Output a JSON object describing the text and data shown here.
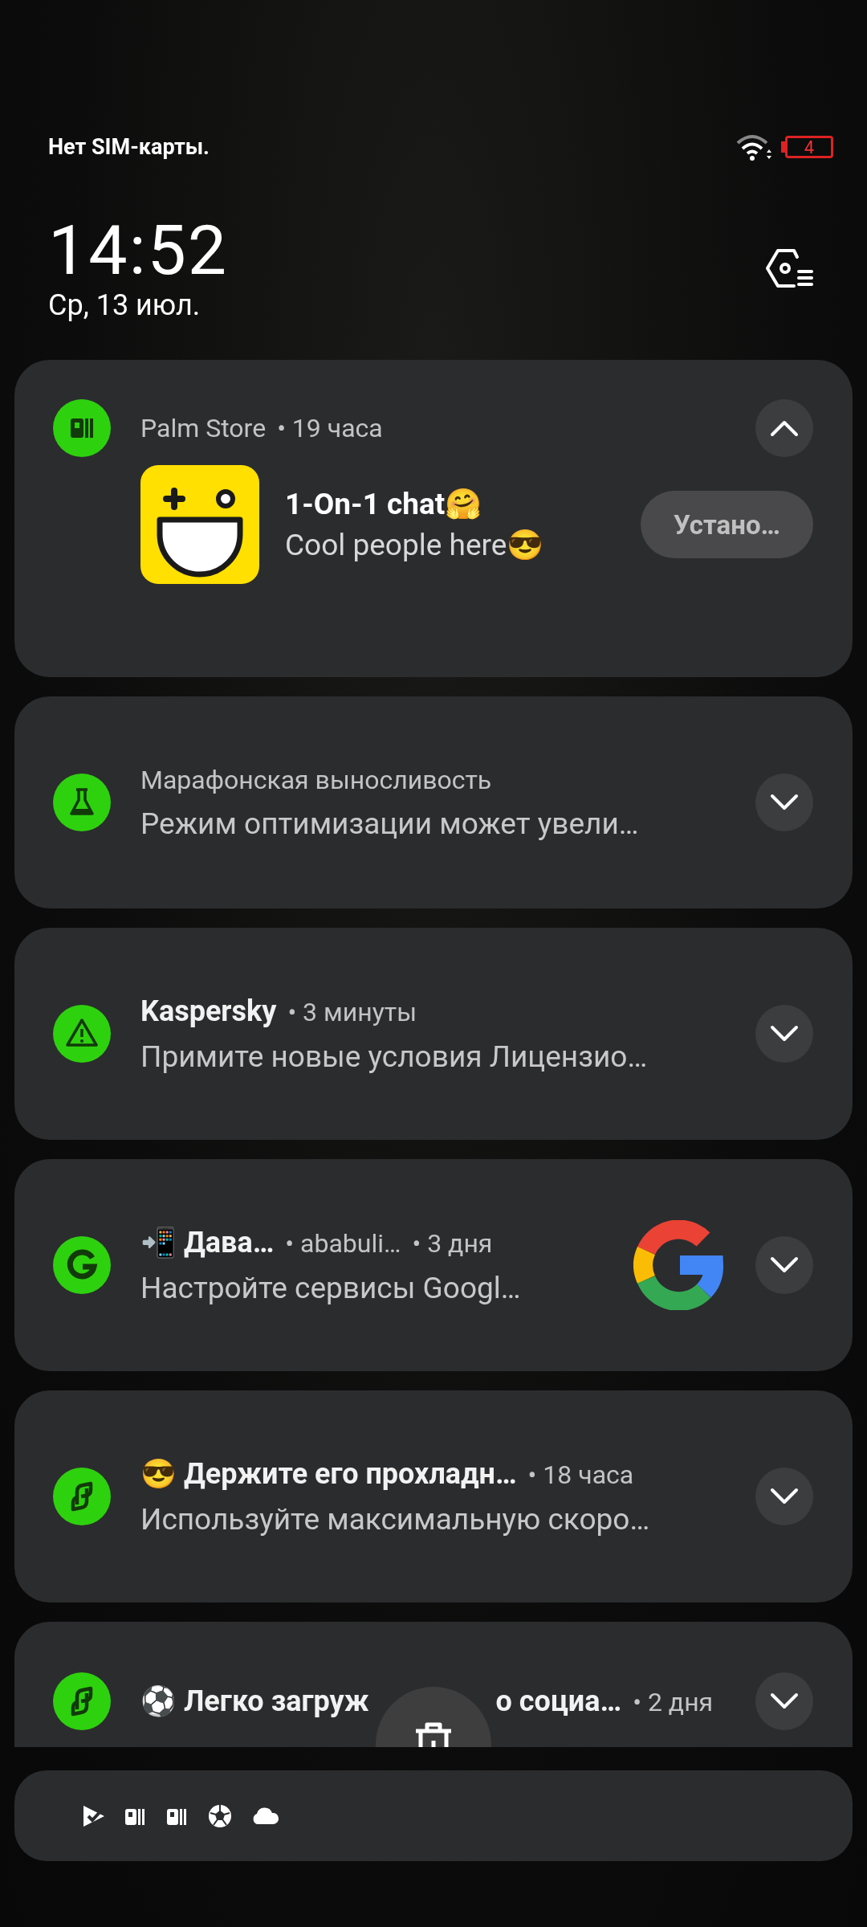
{
  "status_bar": {
    "carrier": "Нет SIM-карты.",
    "battery": "4"
  },
  "clock": {
    "time": "14:52",
    "date": "Ср, 13 июл."
  },
  "notifications": [
    {
      "kind": "install",
      "app": "Palm Store",
      "meta": [
        "• 19 часа"
      ],
      "expanded": true,
      "content_title": "1-On-1 chat🤗",
      "content_body": "Cool people here😎",
      "action": "Устано…"
    },
    {
      "kind": "plain",
      "app": "Марафонская выносливость",
      "expanded": false,
      "body": "Режим оптимизации может увели…"
    },
    {
      "kind": "plain",
      "title": "Kaspersky",
      "meta": [
        "• 3 минуты"
      ],
      "expanded": false,
      "body": "Примите новые условия Лицензио…"
    },
    {
      "kind": "large-icon",
      "title": "📲 Дава…",
      "meta": [
        "• ababuli…",
        "• 3 дня"
      ],
      "expanded": false,
      "body": "Настройте сервисы Googl…"
    },
    {
      "kind": "plain",
      "title": "😎 Держите его прохладн…",
      "meta": [
        "• 18 часа"
      ],
      "expanded": false,
      "body": "Используйте максимальную скоро…"
    },
    {
      "kind": "covered",
      "title_start": "⚽ Легко загруж",
      "title_end": "о социа…",
      "meta": [
        "• 2 дня"
      ],
      "expanded": false
    }
  ]
}
